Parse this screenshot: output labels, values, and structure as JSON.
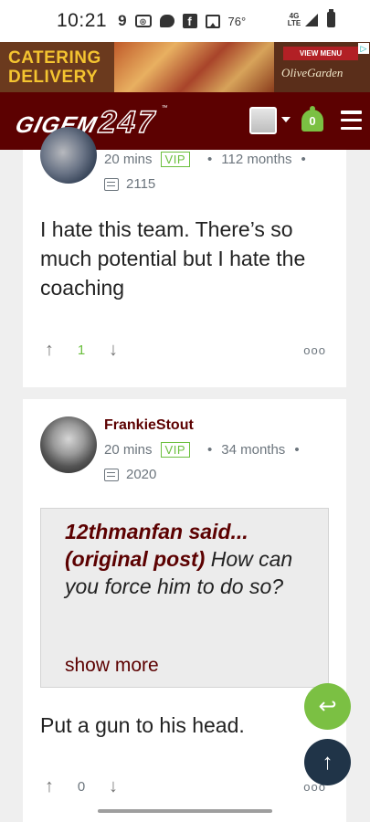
{
  "status_bar": {
    "time": "10:21",
    "temperature": "76°",
    "network": "4G LTE",
    "icons": [
      "notification-icon",
      "radio-icon",
      "message-icon",
      "facebook-icon",
      "image-icon"
    ]
  },
  "ad": {
    "line1": "CATERING",
    "line2": "DELIVERY",
    "button": "VIEW MENU",
    "brand": "OliveGarden"
  },
  "header": {
    "logo_gigem": "GIGEM",
    "logo_247": "247",
    "logo_tm": "™",
    "notification_count": "0"
  },
  "posts": [
    {
      "username": "",
      "time": "20 mins",
      "badge": "VIP",
      "tenure": "112 months",
      "post_count": "2115",
      "body": "I hate this team. There’s so much potential but I hate the coaching",
      "upvotes": "1"
    },
    {
      "username": "FrankieStout",
      "time": "20 mins",
      "badge": "VIP",
      "tenure": "34 months",
      "post_count": "2020",
      "quote": {
        "author": "12thmanfan said...",
        "original": "(original post)",
        "text": "How can you force him to do so?",
        "show_more": "show more"
      },
      "body": "Put a gun to his head.",
      "upvotes": "0"
    }
  ],
  "colors": {
    "brand_maroon": "#5c0101",
    "accent_green": "#7bc043",
    "fab_dark": "#203448"
  }
}
